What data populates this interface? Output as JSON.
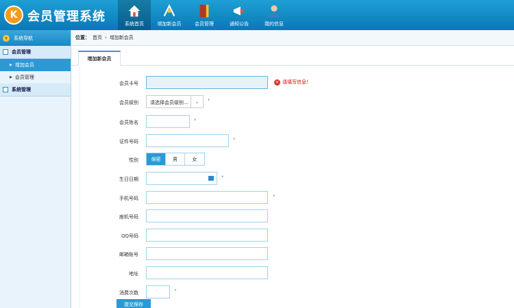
{
  "app": {
    "logo_text": "K",
    "title": "会员管理系统"
  },
  "nav": [
    {
      "label": "系统首页",
      "icon": "home-icon",
      "active": true
    },
    {
      "label": "增加新会员",
      "icon": "add-member-icon",
      "active": false
    },
    {
      "label": "会员管理",
      "icon": "book-icon",
      "active": false
    },
    {
      "label": "通知公告",
      "icon": "megaphone-icon",
      "active": false
    },
    {
      "label": "我的信息",
      "icon": "user-icon",
      "active": false
    }
  ],
  "sidebar": {
    "header": "系统导航",
    "groups": [
      {
        "label": "会员管理",
        "items": [
          {
            "label": "增加会员",
            "active": true
          },
          {
            "label": "会员管理",
            "active": false
          }
        ]
      },
      {
        "label": "系统管理",
        "items": []
      }
    ]
  },
  "breadcrumb": {
    "prefix": "位置：",
    "items": [
      "首页",
      "增加新会员"
    ],
    "sep": "›"
  },
  "tab": {
    "label": "增加新会员"
  },
  "form": {
    "card_no": {
      "label": "会员卡号",
      "value": "",
      "error": "请填写信息！"
    },
    "level": {
      "label": "会员级别",
      "placeholder": "请选择会员级别...",
      "required": "*"
    },
    "name": {
      "label": "会员姓名",
      "value": "",
      "required": "*"
    },
    "id_no": {
      "label": "证件号码",
      "value": "",
      "required": "*"
    },
    "gender": {
      "label": "性别",
      "options": [
        "保密",
        "男",
        "女"
      ],
      "selected": "保密"
    },
    "birthday": {
      "label": "生日日期",
      "value": "",
      "required": "*"
    },
    "mobile": {
      "label": "手机号码",
      "value": "",
      "required": "*"
    },
    "tel": {
      "label": "座机号码",
      "value": ""
    },
    "qq": {
      "label": "QQ号码",
      "value": ""
    },
    "email": {
      "label": "邮箱账号",
      "value": ""
    },
    "address": {
      "label": "地址",
      "value": ""
    },
    "consume": {
      "label": "消费次数",
      "value": "",
      "required": "*"
    },
    "submit_label": "提交保存"
  },
  "colors": {
    "header": "#0a78b6",
    "accent": "#2a9ad6",
    "error": "#d9342b"
  }
}
